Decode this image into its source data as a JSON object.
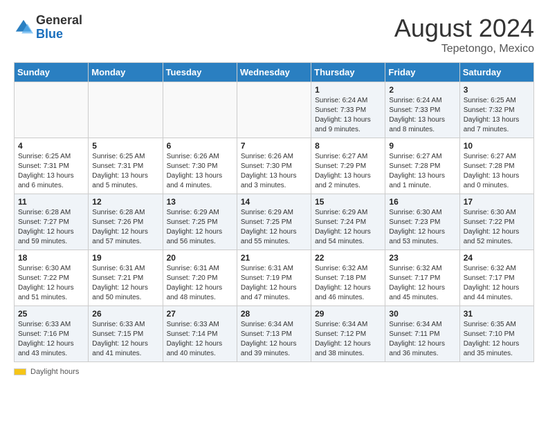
{
  "header": {
    "logo_general": "General",
    "logo_blue": "Blue",
    "month_title": "August 2024",
    "subtitle": "Tepetongo, Mexico"
  },
  "days_of_week": [
    "Sunday",
    "Monday",
    "Tuesday",
    "Wednesday",
    "Thursday",
    "Friday",
    "Saturday"
  ],
  "footer": {
    "label": "Daylight hours"
  },
  "weeks": [
    [
      {
        "day": "",
        "info": ""
      },
      {
        "day": "",
        "info": ""
      },
      {
        "day": "",
        "info": ""
      },
      {
        "day": "",
        "info": ""
      },
      {
        "day": "1",
        "info": "Sunrise: 6:24 AM\nSunset: 7:33 PM\nDaylight: 13 hours and 9 minutes."
      },
      {
        "day": "2",
        "info": "Sunrise: 6:24 AM\nSunset: 7:33 PM\nDaylight: 13 hours and 8 minutes."
      },
      {
        "day": "3",
        "info": "Sunrise: 6:25 AM\nSunset: 7:32 PM\nDaylight: 13 hours and 7 minutes."
      }
    ],
    [
      {
        "day": "4",
        "info": "Sunrise: 6:25 AM\nSunset: 7:31 PM\nDaylight: 13 hours and 6 minutes."
      },
      {
        "day": "5",
        "info": "Sunrise: 6:25 AM\nSunset: 7:31 PM\nDaylight: 13 hours and 5 minutes."
      },
      {
        "day": "6",
        "info": "Sunrise: 6:26 AM\nSunset: 7:30 PM\nDaylight: 13 hours and 4 minutes."
      },
      {
        "day": "7",
        "info": "Sunrise: 6:26 AM\nSunset: 7:30 PM\nDaylight: 13 hours and 3 minutes."
      },
      {
        "day": "8",
        "info": "Sunrise: 6:27 AM\nSunset: 7:29 PM\nDaylight: 13 hours and 2 minutes."
      },
      {
        "day": "9",
        "info": "Sunrise: 6:27 AM\nSunset: 7:28 PM\nDaylight: 13 hours and 1 minute."
      },
      {
        "day": "10",
        "info": "Sunrise: 6:27 AM\nSunset: 7:28 PM\nDaylight: 13 hours and 0 minutes."
      }
    ],
    [
      {
        "day": "11",
        "info": "Sunrise: 6:28 AM\nSunset: 7:27 PM\nDaylight: 12 hours and 59 minutes."
      },
      {
        "day": "12",
        "info": "Sunrise: 6:28 AM\nSunset: 7:26 PM\nDaylight: 12 hours and 57 minutes."
      },
      {
        "day": "13",
        "info": "Sunrise: 6:29 AM\nSunset: 7:25 PM\nDaylight: 12 hours and 56 minutes."
      },
      {
        "day": "14",
        "info": "Sunrise: 6:29 AM\nSunset: 7:25 PM\nDaylight: 12 hours and 55 minutes."
      },
      {
        "day": "15",
        "info": "Sunrise: 6:29 AM\nSunset: 7:24 PM\nDaylight: 12 hours and 54 minutes."
      },
      {
        "day": "16",
        "info": "Sunrise: 6:30 AM\nSunset: 7:23 PM\nDaylight: 12 hours and 53 minutes."
      },
      {
        "day": "17",
        "info": "Sunrise: 6:30 AM\nSunset: 7:22 PM\nDaylight: 12 hours and 52 minutes."
      }
    ],
    [
      {
        "day": "18",
        "info": "Sunrise: 6:30 AM\nSunset: 7:22 PM\nDaylight: 12 hours and 51 minutes."
      },
      {
        "day": "19",
        "info": "Sunrise: 6:31 AM\nSunset: 7:21 PM\nDaylight: 12 hours and 50 minutes."
      },
      {
        "day": "20",
        "info": "Sunrise: 6:31 AM\nSunset: 7:20 PM\nDaylight: 12 hours and 48 minutes."
      },
      {
        "day": "21",
        "info": "Sunrise: 6:31 AM\nSunset: 7:19 PM\nDaylight: 12 hours and 47 minutes."
      },
      {
        "day": "22",
        "info": "Sunrise: 6:32 AM\nSunset: 7:18 PM\nDaylight: 12 hours and 46 minutes."
      },
      {
        "day": "23",
        "info": "Sunrise: 6:32 AM\nSunset: 7:17 PM\nDaylight: 12 hours and 45 minutes."
      },
      {
        "day": "24",
        "info": "Sunrise: 6:32 AM\nSunset: 7:17 PM\nDaylight: 12 hours and 44 minutes."
      }
    ],
    [
      {
        "day": "25",
        "info": "Sunrise: 6:33 AM\nSunset: 7:16 PM\nDaylight: 12 hours and 43 minutes."
      },
      {
        "day": "26",
        "info": "Sunrise: 6:33 AM\nSunset: 7:15 PM\nDaylight: 12 hours and 41 minutes."
      },
      {
        "day": "27",
        "info": "Sunrise: 6:33 AM\nSunset: 7:14 PM\nDaylight: 12 hours and 40 minutes."
      },
      {
        "day": "28",
        "info": "Sunrise: 6:34 AM\nSunset: 7:13 PM\nDaylight: 12 hours and 39 minutes."
      },
      {
        "day": "29",
        "info": "Sunrise: 6:34 AM\nSunset: 7:12 PM\nDaylight: 12 hours and 38 minutes."
      },
      {
        "day": "30",
        "info": "Sunrise: 6:34 AM\nSunset: 7:11 PM\nDaylight: 12 hours and 36 minutes."
      },
      {
        "day": "31",
        "info": "Sunrise: 6:35 AM\nSunset: 7:10 PM\nDaylight: 12 hours and 35 minutes."
      }
    ]
  ]
}
